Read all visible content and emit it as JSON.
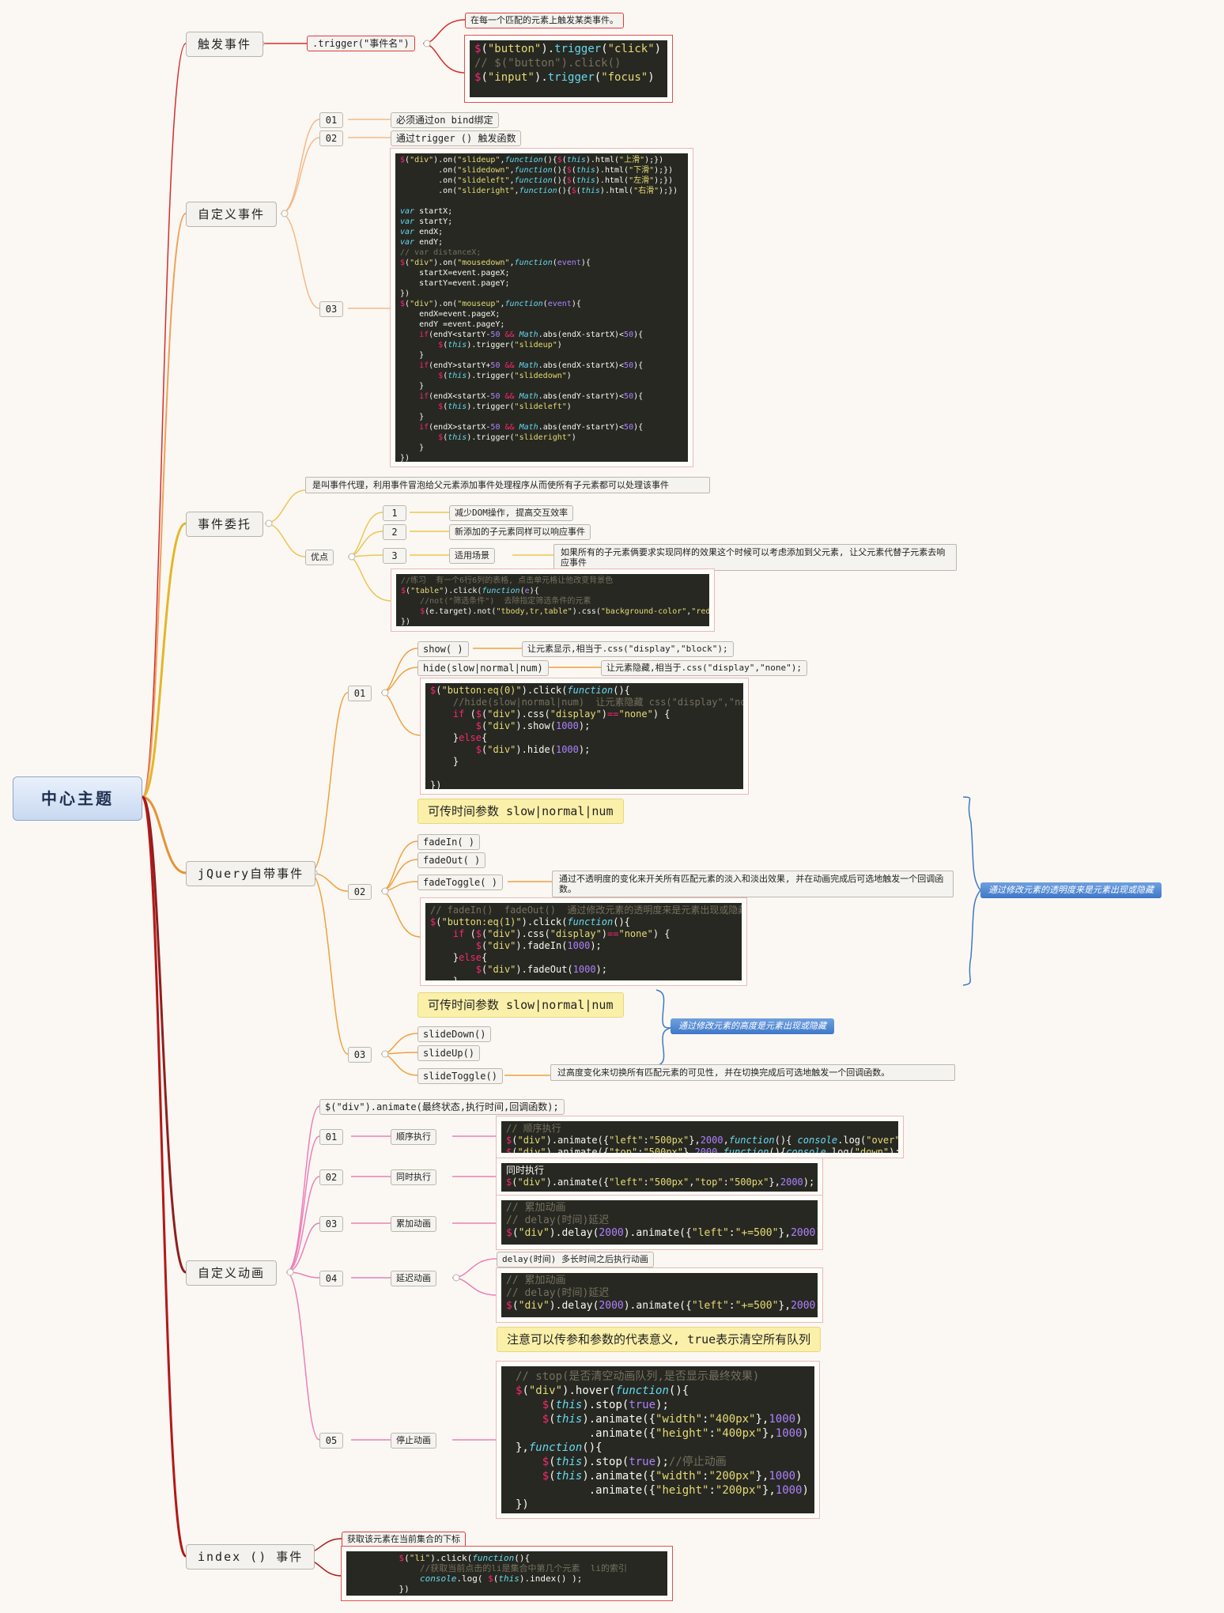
{
  "center": "中心主题",
  "branches": {
    "trigger": {
      "label": "触发事件",
      "method": ".trigger(\"事件名\")",
      "desc": "在每一个匹配的元素上触发某类事件。"
    },
    "custom_event": {
      "label": "自定义事件",
      "items": [
        {
          "num": "01",
          "text": "必须通过on bind绑定"
        },
        {
          "num": "02",
          "text": "通过trigger () 触发函数"
        },
        {
          "num": "03",
          "text": ""
        }
      ]
    },
    "delegate": {
      "label": "事件委托",
      "desc": "是叫事件代理，利用事件冒泡给父元素添加事件处理程序从而使所有子元素都可以处理该事件",
      "advantage": "优点",
      "items": [
        {
          "num": "1",
          "text": "减少DOM操作, 提高交互效率"
        },
        {
          "num": "2",
          "text": "新添加的子元素同样可以响应事件"
        },
        {
          "num": "3",
          "text": "适用场景"
        }
      ],
      "scene_desc": "如果所有的子元素俩要求实现同样的效果这个时候可以考虑添加到父元素, 让父元素代替子元素去响应事件"
    },
    "jquery": {
      "label": "jQuery自带事件",
      "group1": {
        "num": "01",
        "show": "show(  )",
        "show_desc": "让元素显示,相当于.css(\"display\",\"block\");",
        "hide": "hide(slow|normal|num)",
        "hide_desc": "让元素隐藏,相当于.css(\"display\",\"none\");"
      },
      "param_note": "可传时间参数  slow|normal|num",
      "group2": {
        "num": "02",
        "fadein": "fadeIn(  )",
        "fadeout": "fadeOut(  )",
        "fadetoggle": "fadeToggle( )",
        "fadetoggle_desc": "通过不透明度的变化来开关所有匹配元素的淡入和淡出效果, 并在动画完成后可选地触发一个回调函数。"
      },
      "opacity_note": "通过修改元素的透明度来是元素出现或隐藏",
      "param_note2": "可传时间参数  slow|normal|num",
      "height_note": "通过修改元素的高度是元素出现或隐藏",
      "group3": {
        "num": "03",
        "slidedown": "slideDown()",
        "slideup": "slideUp()",
        "slidetoggle": "slideToggle()",
        "slidetoggle_desc": "过高度变化来切换所有匹配元素的可见性, 并在切换完成后可选地触发一个回调函数。"
      }
    },
    "animate": {
      "label": "自定义动画",
      "syntax": "$(\"div\").animate(最终状态,执行时间,回调函数);",
      "items": [
        {
          "num": "01",
          "text": "顺序执行"
        },
        {
          "num": "02",
          "text": "同时执行"
        },
        {
          "num": "03",
          "text": "累加动画"
        },
        {
          "num": "04",
          "text": "延迟动画"
        },
        {
          "num": "05",
          "text": "停止动画"
        }
      ],
      "delay_desc": "delay(时间)    多长时间之后执行动画",
      "stop_note": "注意可以传参和参数的代表意义, true表示清空所有队列"
    },
    "index": {
      "label": "index () 事件",
      "desc": "获取该元素在当前集合的下标"
    }
  }
}
